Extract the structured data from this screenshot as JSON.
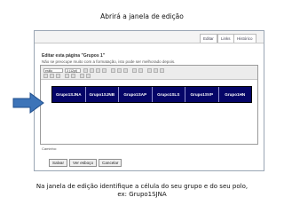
{
  "slide": {
    "top_caption": "Abrirá a janela de edição",
    "bottom_caption_line1": "Na janela de edição identifique a célula do seu grupo e do seu polo,",
    "bottom_caption_line2": "ex: Grupo1SJNA"
  },
  "wiki": {
    "tabs": [
      {
        "label": "Editar"
      },
      {
        "label": "Links"
      },
      {
        "label": "Histórico"
      }
    ],
    "page_title": "Editar esta página \"Grupos 1\"",
    "page_note": "Não se preocupe muito com a formatação, isto pode ser melhorado depois.",
    "toolbar": {
      "style_value": "estilo",
      "size_value": "3 (12pt)"
    },
    "table_cells": [
      "Grupo1SJNA",
      "Grupo1SJNB",
      "Grupo1SAP",
      "Grupo1SLS",
      "Grupo1SVP",
      "Grupo1HN"
    ],
    "path_label": "Caminho:",
    "buttons": {
      "save": "Salvar",
      "preview": "Ver esboço",
      "cancel": "Cancelar"
    }
  },
  "colors": {
    "table_bg": "#050568",
    "arrow_fill": "#3d74b8"
  },
  "icons": {
    "arrow": "right-arrow-icon"
  }
}
